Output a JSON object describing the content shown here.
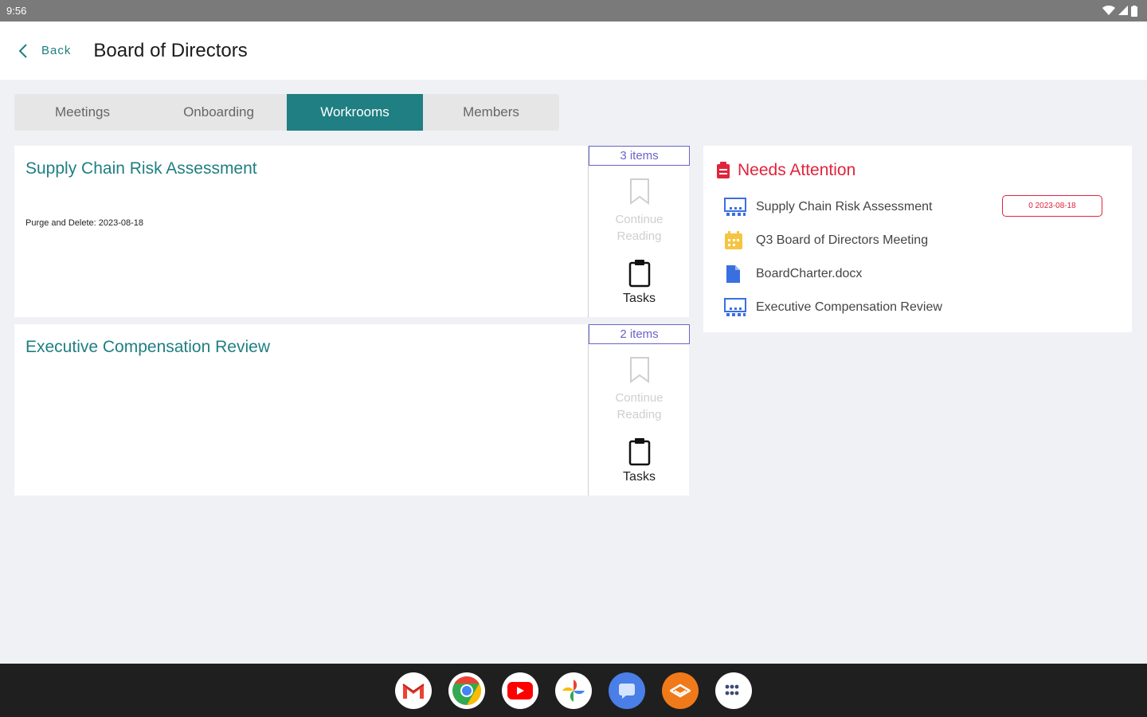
{
  "status": {
    "time": "9:56"
  },
  "header": {
    "back_label": "Back",
    "title": "Board of Directors"
  },
  "tabs": [
    {
      "label": "Meetings"
    },
    {
      "label": "Onboarding"
    },
    {
      "label": "Workrooms"
    },
    {
      "label": "Members"
    }
  ],
  "active_tab": "Workrooms",
  "workrooms": [
    {
      "title": "Supply Chain Risk Assessment",
      "meta": "Purge and Delete: 2023-08-18",
      "items": "3 items",
      "continue_label": "Continue Reading",
      "tasks_label": "Tasks"
    },
    {
      "title": "Executive Compensation Review",
      "meta": "",
      "items": "2 items",
      "continue_label": "Continue Reading",
      "tasks_label": "Tasks"
    }
  ],
  "attention": {
    "title": "Needs Attention",
    "items": [
      {
        "label": "Supply Chain Risk Assessment",
        "icon": "workroom-icon",
        "chip": "0 2023-08-18"
      },
      {
        "label": "Q3 Board of Directors Meeting",
        "icon": "calendar-icon"
      },
      {
        "label": "BoardCharter.docx",
        "icon": "document-icon"
      },
      {
        "label": "Executive Compensation Review",
        "icon": "workroom-icon"
      }
    ]
  },
  "dock": [
    "gmail-icon",
    "chrome-icon",
    "youtube-icon",
    "photos-icon",
    "messages-icon",
    "app-icon",
    "app-drawer-icon"
  ],
  "colors": {
    "accent": "#1f7f82",
    "alert": "#e0243c",
    "badge": "#6a64c8"
  }
}
